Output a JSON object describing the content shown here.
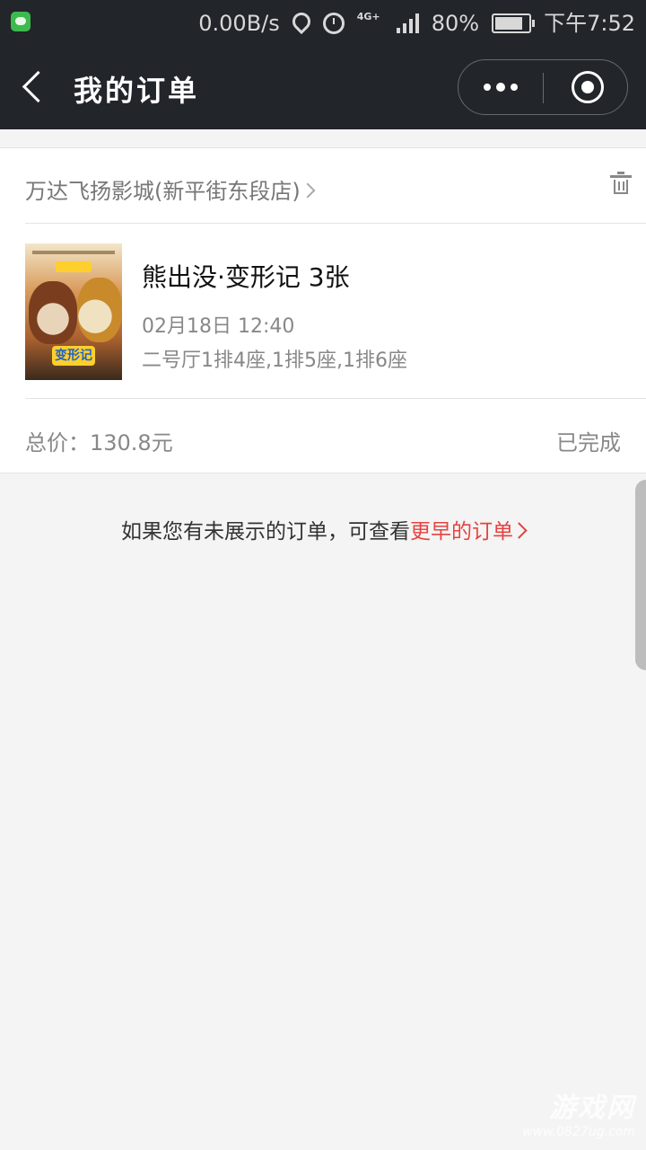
{
  "status_bar": {
    "network_speed": "0.00B/s",
    "network_type": "4G+",
    "battery": "80%",
    "time": "下午7:52"
  },
  "header": {
    "title": "我的订单"
  },
  "order": {
    "cinema": "万达飞扬影城(新平街东段店)",
    "poster_logo": "变形记",
    "movie_title": "熊出没·变形记 3张",
    "show_time": "02月18日 12:40",
    "seats": "二号厅1排4座,1排5座,1排6座",
    "total_price": "总价：130.8元",
    "status": "已完成"
  },
  "footer": {
    "note": "如果您有未展示的订单，可查看",
    "link": "更早的订单"
  },
  "watermark": {
    "title": "游戏网",
    "url": "www.0827ug.com"
  },
  "colors": {
    "header_bg": "#22252a",
    "link": "#e64340",
    "page_bg": "#f4f4f4"
  }
}
